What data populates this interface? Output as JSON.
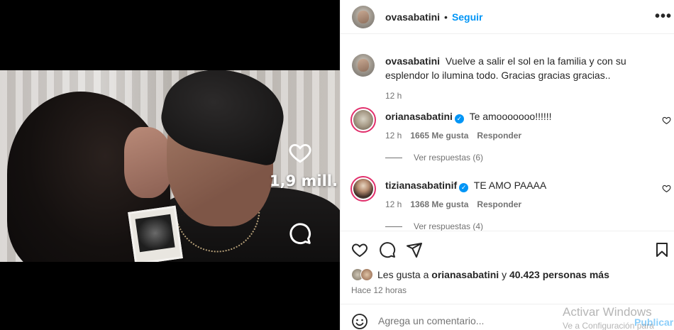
{
  "post": {
    "owner": "ovasabatini",
    "dot": "•",
    "follow_label": "Seguir",
    "more_label": "•••",
    "caption_text": "Vuelve a salir el sol en la familia y con su esplendor lo ilumina todo. Gracias gracias gracias..",
    "caption_time": "12 h",
    "media_likes_overlay": "1,9 mill."
  },
  "comments": [
    {
      "username": "orianasabatini",
      "verified": true,
      "text": "Te amooooooo!!!!!!",
      "time": "12 h",
      "likes": "1665 Me gusta",
      "reply_label": "Responder",
      "view_replies": "Ver respuestas (6)",
      "avatar_icon": "cat-avatar"
    },
    {
      "username": "tizianasabatinif",
      "verified": true,
      "text": "TE AMO PAAAA",
      "time": "12 h",
      "likes": "1368 Me gusta",
      "reply_label": "Responder",
      "view_replies": "Ver respuestas (4)",
      "avatar_icon": "woman-avatar"
    }
  ],
  "engagement": {
    "liked_by_prefix": "Les gusta a",
    "liked_by_user": "orianasabatini",
    "liked_by_connector": "y",
    "liked_by_rest": "40.423 personas más",
    "posted_when": "Hace 12 horas"
  },
  "composer": {
    "placeholder": "Agrega un comentario...",
    "publish_label": "Publicar"
  },
  "os_watermark": {
    "line1": "Activar Windows",
    "line2": "Ve a Configuración para"
  },
  "icons": {
    "like": "heart-icon",
    "comment": "comment-icon",
    "share": "send-icon",
    "save": "bookmark-icon",
    "emoji": "emoji-icon",
    "verified": "verified-badge-icon"
  },
  "colors": {
    "link_blue": "#0095f6",
    "muted": "#737373",
    "text": "#262626",
    "story_ring": "#e1306c"
  }
}
